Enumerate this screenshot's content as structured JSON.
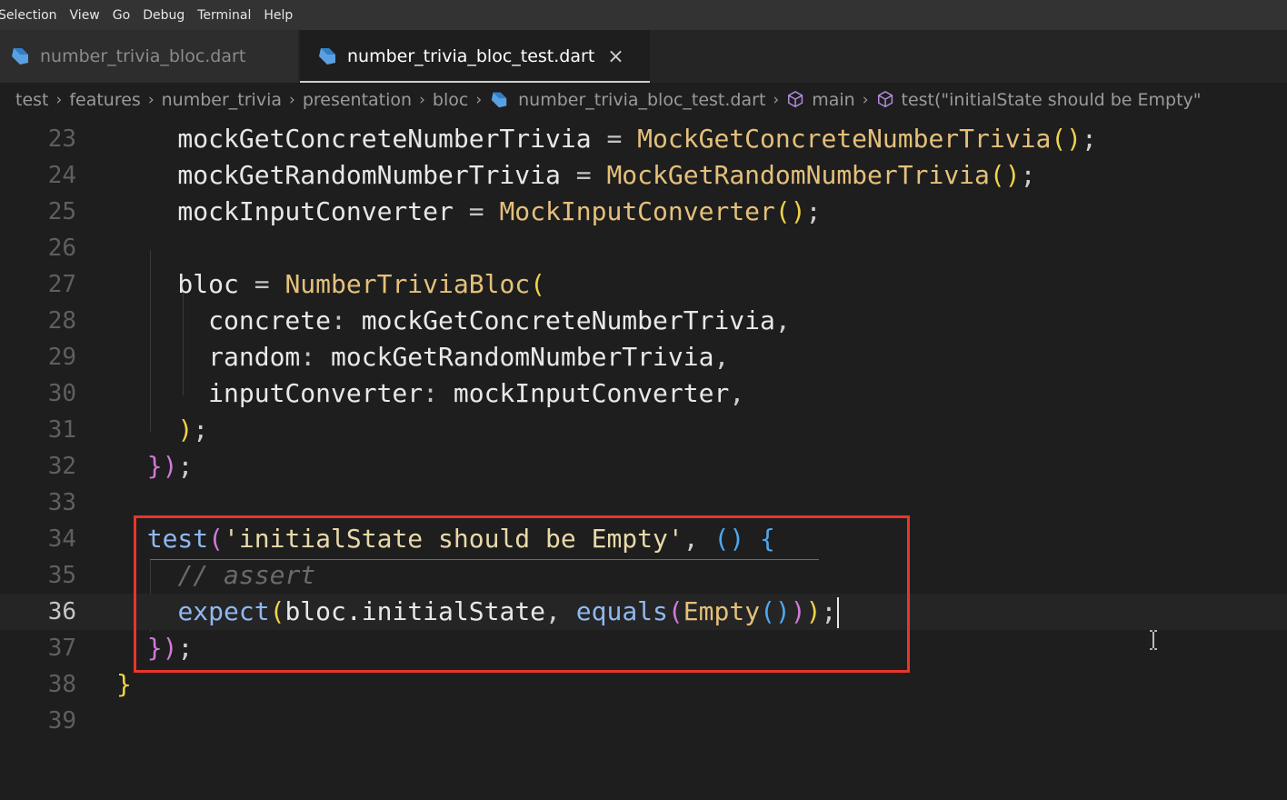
{
  "menubar": {
    "items": [
      "Selection",
      "View",
      "Go",
      "Debug",
      "Terminal",
      "Help"
    ]
  },
  "tabs": [
    {
      "label": "number_trivia_bloc.dart",
      "icon": "dart-icon",
      "active": false
    },
    {
      "label": "number_trivia_bloc_test.dart",
      "icon": "dart-icon",
      "active": true,
      "close_icon": "×"
    }
  ],
  "breadcrumbs": [
    {
      "label": "test"
    },
    {
      "label": "features"
    },
    {
      "label": "number_trivia"
    },
    {
      "label": "presentation"
    },
    {
      "label": "bloc"
    },
    {
      "label": "number_trivia_bloc_test.dart",
      "icon": "dart-icon"
    },
    {
      "label": "main",
      "icon": "cube-icon"
    },
    {
      "label": "test(\"initialState should be Empty\"",
      "icon": "cube-icon"
    }
  ],
  "editor": {
    "current_line": 36,
    "lines": [
      {
        "n": "23",
        "tokens": [
          [
            "t-plain",
            "    mockGetConcreteNumberTrivia "
          ],
          [
            "t-op",
            "="
          ],
          [
            "t-plain",
            " "
          ],
          [
            "t-class",
            "MockGetConcreteNumberTrivia"
          ],
          [
            "t-paren1",
            "()"
          ],
          [
            "t-punc",
            ";"
          ]
        ]
      },
      {
        "n": "24",
        "tokens": [
          [
            "t-plain",
            "    mockGetRandomNumberTrivia "
          ],
          [
            "t-op",
            "="
          ],
          [
            "t-plain",
            " "
          ],
          [
            "t-class",
            "MockGetRandomNumberTrivia"
          ],
          [
            "t-paren1",
            "()"
          ],
          [
            "t-punc",
            ";"
          ]
        ]
      },
      {
        "n": "25",
        "tokens": [
          [
            "t-plain",
            "    mockInputConverter "
          ],
          [
            "t-op",
            "="
          ],
          [
            "t-plain",
            " "
          ],
          [
            "t-class",
            "MockInputConverter"
          ],
          [
            "t-paren1",
            "()"
          ],
          [
            "t-punc",
            ";"
          ]
        ]
      },
      {
        "n": "26",
        "tokens": []
      },
      {
        "n": "27",
        "tokens": [
          [
            "t-plain",
            "    bloc "
          ],
          [
            "t-op",
            "="
          ],
          [
            "t-plain",
            " "
          ],
          [
            "t-class",
            "NumberTriviaBloc"
          ],
          [
            "t-paren1",
            "("
          ]
        ]
      },
      {
        "n": "28",
        "tokens": [
          [
            "t-plain",
            "      concrete"
          ],
          [
            "t-op",
            ":"
          ],
          [
            "t-plain",
            " mockGetConcreteNumberTrivia"
          ],
          [
            "t-punc",
            ","
          ]
        ]
      },
      {
        "n": "29",
        "tokens": [
          [
            "t-plain",
            "      random"
          ],
          [
            "t-op",
            ":"
          ],
          [
            "t-plain",
            " mockGetRandomNumberTrivia"
          ],
          [
            "t-punc",
            ","
          ]
        ]
      },
      {
        "n": "30",
        "tokens": [
          [
            "t-plain",
            "      inputConverter"
          ],
          [
            "t-op",
            ":"
          ],
          [
            "t-plain",
            " mockInputConverter"
          ],
          [
            "t-punc",
            ","
          ]
        ]
      },
      {
        "n": "31",
        "tokens": [
          [
            "t-plain",
            "    "
          ],
          [
            "t-paren1",
            ")"
          ],
          [
            "t-punc",
            ";"
          ]
        ]
      },
      {
        "n": "32",
        "tokens": [
          [
            "t-plain",
            "  "
          ],
          [
            "t-paren2",
            "}"
          ],
          [
            "t-paren2",
            ")"
          ],
          [
            "t-punc",
            ";"
          ]
        ]
      },
      {
        "n": "33",
        "tokens": []
      },
      {
        "n": "34",
        "tokens": [
          [
            "t-plain",
            "  "
          ],
          [
            "t-func",
            "test"
          ],
          [
            "t-paren2",
            "("
          ],
          [
            "t-string",
            "'initialState should be Empty'"
          ],
          [
            "t-punc",
            ","
          ],
          [
            "t-plain",
            " "
          ],
          [
            "t-paren3",
            "()"
          ],
          [
            "t-plain",
            " "
          ],
          [
            "t-paren3",
            "{"
          ]
        ]
      },
      {
        "n": "35",
        "tokens": [
          [
            "t-plain",
            "    "
          ],
          [
            "t-comment",
            "// assert"
          ]
        ]
      },
      {
        "n": "36",
        "tokens": [
          [
            "t-plain",
            "    "
          ],
          [
            "t-func",
            "expect"
          ],
          [
            "t-paren1",
            "("
          ],
          [
            "t-plain",
            "bloc.initialState"
          ],
          [
            "t-punc",
            ","
          ],
          [
            "t-plain",
            " "
          ],
          [
            "t-func",
            "equals"
          ],
          [
            "t-paren2",
            "("
          ],
          [
            "t-class",
            "Empty"
          ],
          [
            "t-paren3",
            "()"
          ],
          [
            "t-paren2",
            ")"
          ],
          [
            "t-paren1",
            ")"
          ],
          [
            "t-punc",
            ";"
          ]
        ],
        "cursor": true
      },
      {
        "n": "37",
        "tokens": [
          [
            "t-plain",
            "  "
          ],
          [
            "t-paren2",
            "}"
          ],
          [
            "t-paren2",
            ")"
          ],
          [
            "t-punc",
            ";"
          ]
        ]
      },
      {
        "n": "38",
        "tokens": [
          [
            "t-paren1",
            "}"
          ]
        ]
      },
      {
        "n": "39",
        "tokens": []
      }
    ]
  },
  "colors": {
    "highlight_box": "#e8362a",
    "background": "#1e1e1e"
  }
}
